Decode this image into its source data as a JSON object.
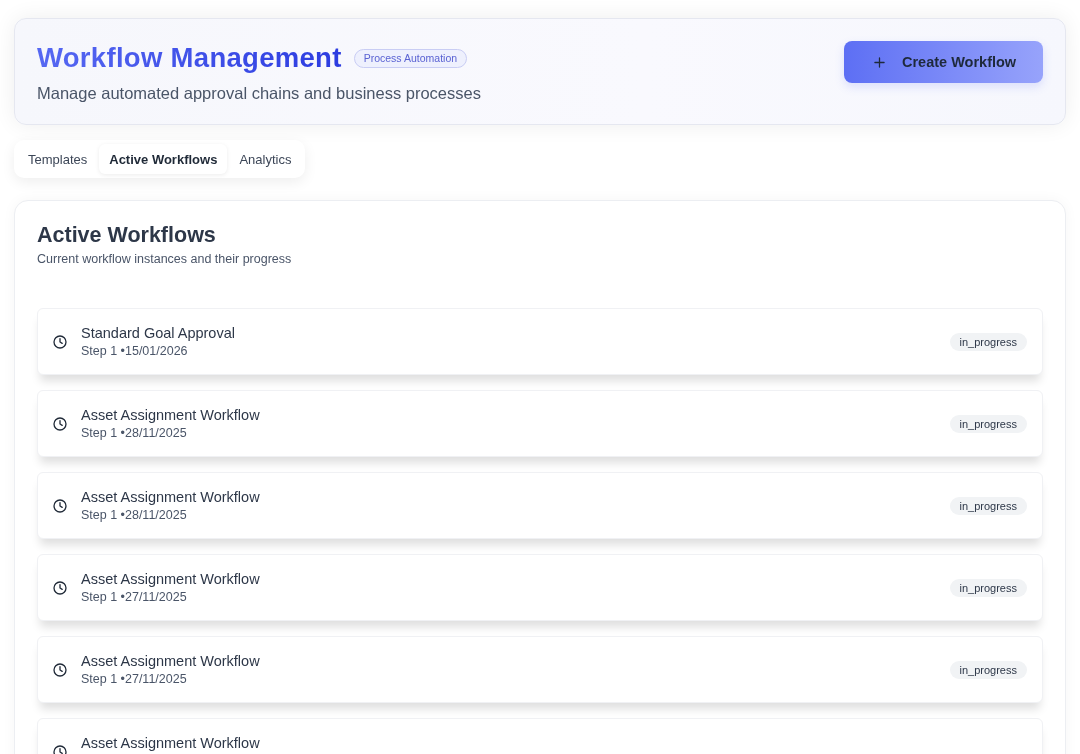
{
  "header": {
    "title": "Workflow Management",
    "badge": "Process Automation",
    "subtitle": "Manage automated approval chains and business processes",
    "create_button": "Create Workflow"
  },
  "tabs": [
    {
      "label": "Templates",
      "selected": false
    },
    {
      "label": "Active Workflows",
      "selected": true
    },
    {
      "label": "Analytics",
      "selected": false
    }
  ],
  "panel": {
    "title": "Active Workflows",
    "subtitle": "Current workflow instances and their progress",
    "workflows": [
      {
        "name": "Standard Goal Approval",
        "meta": "Step 1 •15/01/2026",
        "status": "in_progress"
      },
      {
        "name": "Asset Assignment Workflow",
        "meta": "Step 1 •28/11/2025",
        "status": "in_progress"
      },
      {
        "name": "Asset Assignment Workflow",
        "meta": "Step 1 •28/11/2025",
        "status": "in_progress"
      },
      {
        "name": "Asset Assignment Workflow",
        "meta": "Step 1 •27/11/2025",
        "status": "in_progress"
      },
      {
        "name": "Asset Assignment Workflow",
        "meta": "Step 1 •27/11/2025",
        "status": "in_progress"
      },
      {
        "name": "Asset Assignment Workflow"
      }
    ]
  }
}
